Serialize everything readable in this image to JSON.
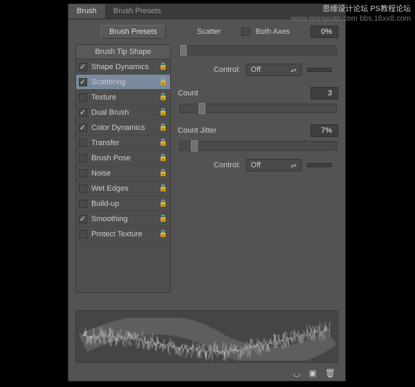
{
  "tabs": {
    "brush": "Brush",
    "presets": "Brush Presets"
  },
  "toolbar": {
    "presets_btn": "Brush Presets"
  },
  "scatter": {
    "label": "Scatter",
    "both_axes_label": "Both Axes",
    "both_axes_on": false,
    "value": "0%",
    "thumb_pct": 0
  },
  "control1": {
    "label": "Control:",
    "value": "Off"
  },
  "count": {
    "label": "Count",
    "value": "3",
    "thumb_pct": 12
  },
  "count_jitter": {
    "label": "Count Jitter",
    "value": "7%",
    "thumb_pct": 7
  },
  "control2": {
    "label": "Control:",
    "value": "Off"
  },
  "sidebar": {
    "header": "Brush Tip Shape",
    "items": [
      {
        "label": "Shape Dynamics",
        "checked": true,
        "locked": true
      },
      {
        "label": "Scattering",
        "checked": true,
        "locked": true,
        "selected": true
      },
      {
        "label": "Texture",
        "checked": false,
        "locked": true
      },
      {
        "label": "Dual Brush",
        "checked": true,
        "locked": true
      },
      {
        "label": "Color Dynamics",
        "checked": true,
        "locked": true
      },
      {
        "label": "Transfer",
        "checked": false,
        "locked": true
      },
      {
        "label": "Brush Pose",
        "checked": false,
        "locked": true
      },
      {
        "label": "Noise",
        "checked": false,
        "locked": true
      },
      {
        "label": "Wet Edges",
        "checked": false,
        "locked": true
      },
      {
        "label": "Build-up",
        "checked": false,
        "locked": true
      },
      {
        "label": "Smoothing",
        "checked": true,
        "locked": true
      },
      {
        "label": "Protect Texture",
        "checked": false,
        "locked": true
      }
    ]
  },
  "watermark": {
    "l1": "思缘设计论坛  PS教程论坛",
    "l2": "www.missyuan.com  bbs.16xx8.com"
  }
}
